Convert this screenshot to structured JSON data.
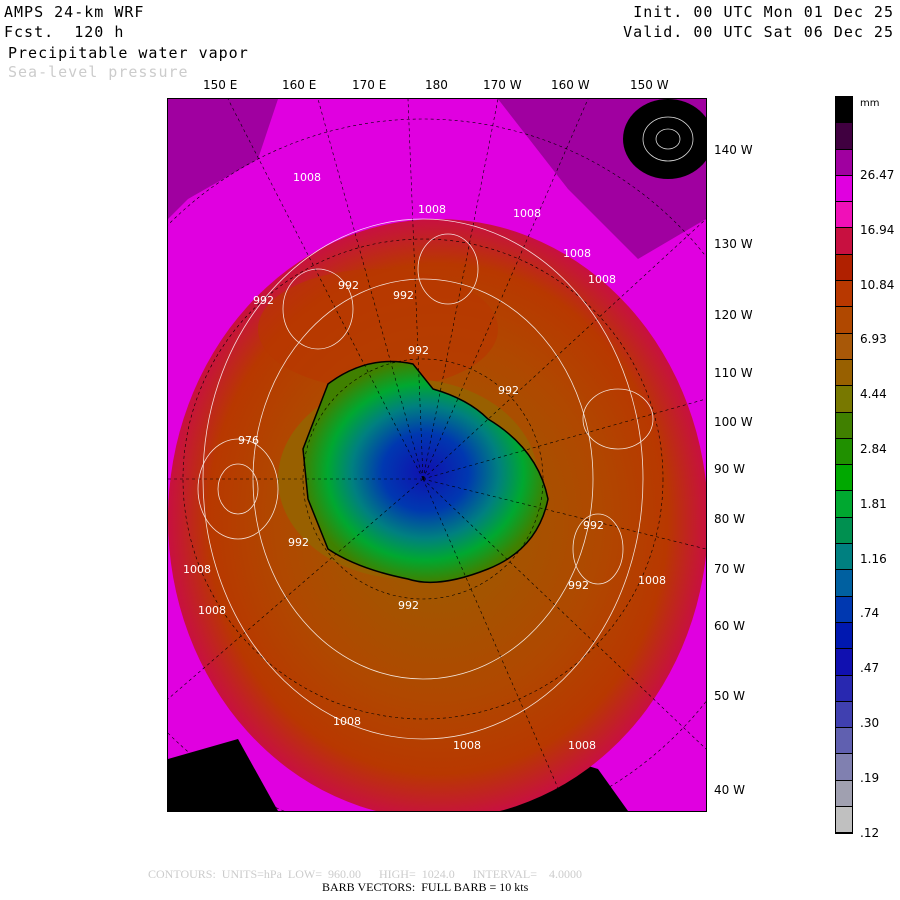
{
  "header": {
    "model": "AMPS 24-km WRF",
    "forecast": "Fcst.  120 h",
    "field": "Precipitable water vapor",
    "overlay": "Sea-level pressure",
    "init": "Init. 00 UTC Mon 01 Dec 25",
    "valid": "Valid. 00 UTC Sat 06 Dec 25"
  },
  "top_longitudes": [
    "150 E",
    "160 E",
    "170 E",
    "180",
    "170 W",
    "160 W",
    "150 W"
  ],
  "right_longitudes": [
    "140 W",
    "130 W",
    "120 W",
    "110 W",
    "100 W",
    "90 W",
    "80 W",
    "70 W",
    "60 W",
    "50 W",
    "40 W"
  ],
  "colorbar": {
    "unit": "mm",
    "labels": [
      "26.47",
      "16.94",
      "10.84",
      "6.93",
      "4.44",
      "2.84",
      "1.81",
      "1.16",
      ".74",
      ".47",
      ".30",
      ".19",
      ".12"
    ],
    "colors": [
      "#000000",
      "#400040",
      "#a000a0",
      "#e000e0",
      "#f010b8",
      "#c81040",
      "#b02000",
      "#b83800",
      "#b04800",
      "#a85808",
      "#986000",
      "#787800",
      "#408000",
      "#209000",
      "#00a800",
      "#00a830",
      "#009050",
      "#008080",
      "#0060a0",
      "#0038b0",
      "#0018b0",
      "#1010b0",
      "#2828b0",
      "#4040b0",
      "#6060b0",
      "#8080b0",
      "#a0a0b0",
      "#c0c0c0"
    ]
  },
  "isobar_labels": [
    "1008",
    "1008",
    "1008",
    "1008",
    "1008",
    "992",
    "992",
    "992",
    "992",
    "992",
    "976",
    "992",
    "1008",
    "992",
    "992",
    "992",
    "1008",
    "1008",
    "1008",
    "1008",
    "1008"
  ],
  "footer": {
    "contours": "CONTOURS:  UNITS=hPa  LOW=  960.00      HIGH=  1024.0      INTERVAL=    4.0000",
    "barbs": "BARB VECTORS:  FULL BARB = 10 kts"
  }
}
